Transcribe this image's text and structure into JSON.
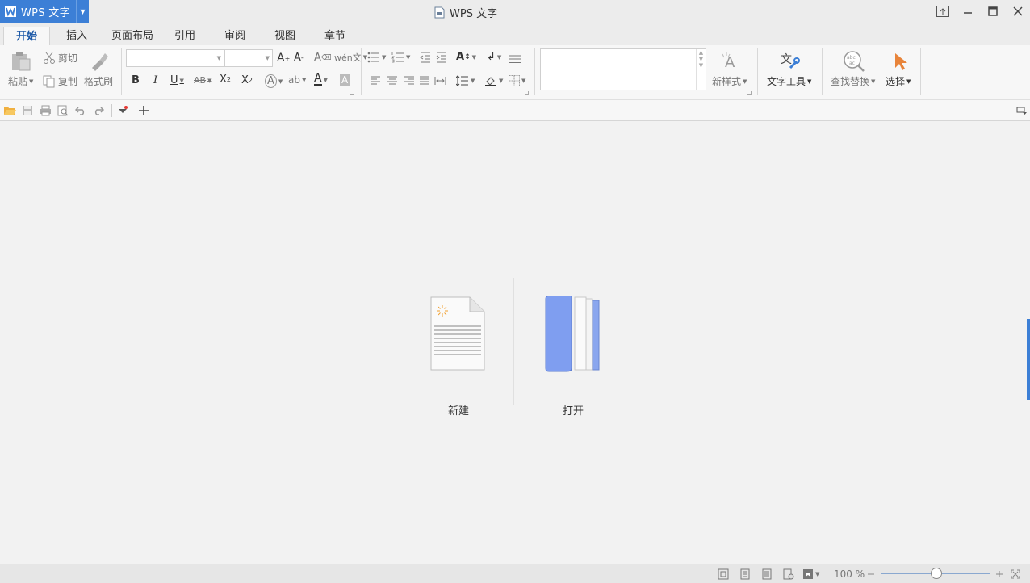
{
  "app": {
    "menu_name": "WPS 文字",
    "window_title": "WPS 文字"
  },
  "tabs": [
    {
      "label": "开始",
      "active": true
    },
    {
      "label": "插入"
    },
    {
      "label": "页面布局"
    },
    {
      "label": "引用"
    },
    {
      "label": "审阅"
    },
    {
      "label": "视图"
    },
    {
      "label": "章节"
    }
  ],
  "ribbon": {
    "paste": "粘贴",
    "cut": "剪切",
    "copy": "复制",
    "format_painter": "格式刷",
    "new_style": "新样式",
    "text_tools": "文字工具",
    "find_replace": "查找替换",
    "select": "选择"
  },
  "start": {
    "new_label": "新建",
    "open_label": "打开"
  },
  "status": {
    "zoom": "100 %"
  },
  "colors": {
    "accent": "#3c7fd6",
    "folder": "#7f9ef0",
    "select_cursor": "#e8843a"
  }
}
